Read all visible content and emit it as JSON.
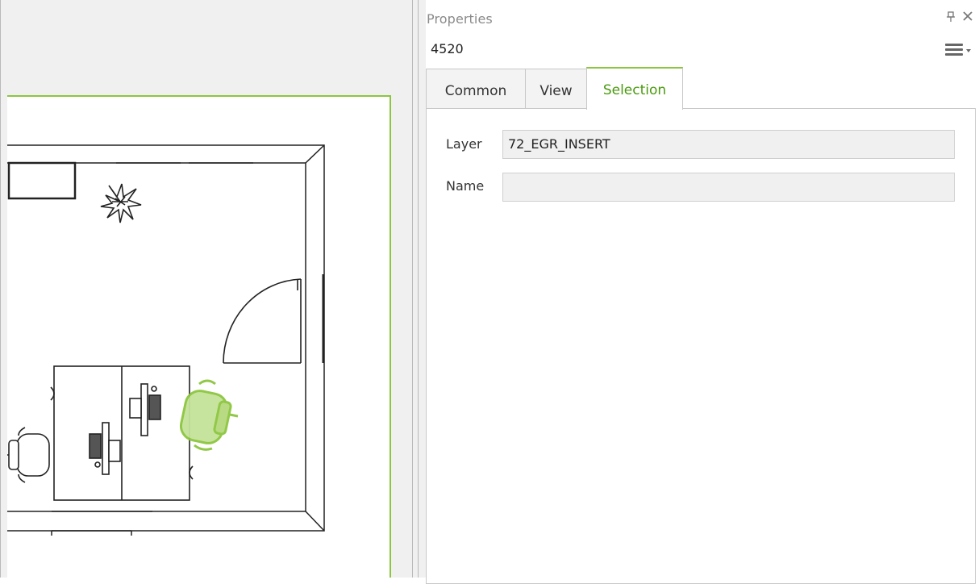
{
  "panel": {
    "title": "Properties",
    "object_id": "4520",
    "pin_icon": "pin-icon",
    "close_icon": "close-icon",
    "menu_icon": "hamburger-menu-icon"
  },
  "tabs": [
    {
      "label": "Common",
      "active": false
    },
    {
      "label": "View",
      "active": false
    },
    {
      "label": "Selection",
      "active": true
    }
  ],
  "fields": {
    "layer": {
      "label": "Layer",
      "value": "72_EGR_INSERT"
    },
    "name": {
      "label": "Name",
      "value": ""
    }
  },
  "colors": {
    "accent": "#8cc63f",
    "active_tab_text": "#4a9a0e",
    "selected_object": "#a6d15a"
  }
}
